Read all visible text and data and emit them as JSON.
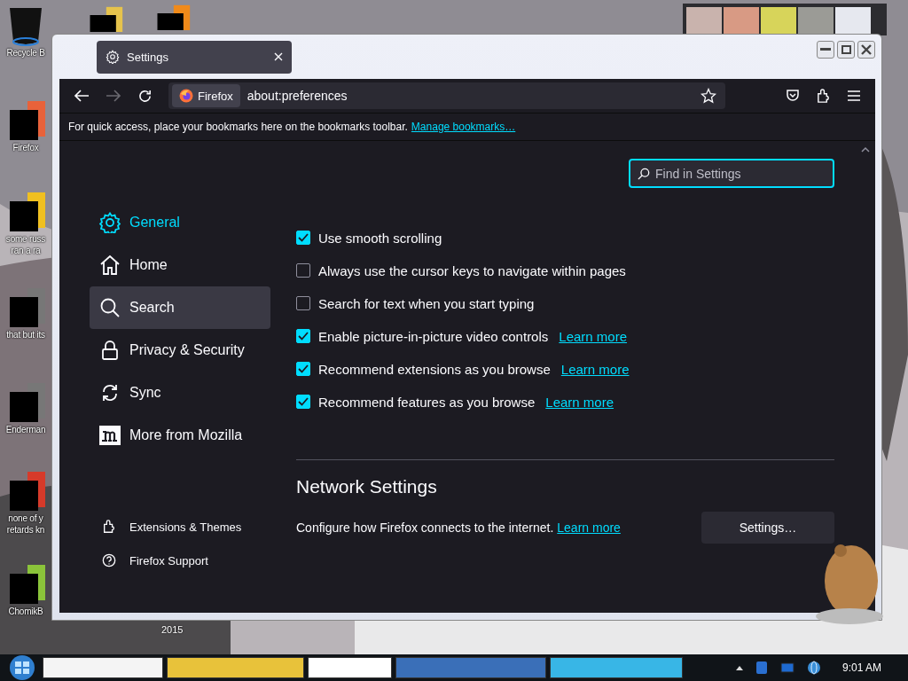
{
  "desktop": {
    "icons": [
      {
        "kind": "bin",
        "label": [
          "Recycle B"
        ]
      },
      {
        "kind": "firefox",
        "label": [
          "Firefox"
        ]
      },
      {
        "kind": "yellow",
        "label": [
          "some russ",
          "ran a ra"
        ]
      },
      {
        "kind": "stack",
        "label": [
          "that but its"
        ]
      },
      {
        "kind": "terminal",
        "label": [
          "Enderman"
        ]
      },
      {
        "kind": "red",
        "label": [
          "none of y",
          "retards kn"
        ]
      },
      {
        "kind": "hamster",
        "label": [
          "ChomikB"
        ]
      },
      {
        "kind": "folder"
      },
      {
        "kind": "orange"
      }
    ],
    "caption": "2015"
  },
  "window": {
    "tab": {
      "title": "Settings",
      "selected": true
    },
    "toolbar": {
      "identity": "Firefox",
      "url": "about:preferences"
    },
    "bookmarks_bar": {
      "text": "For quick access, place your bookmarks here on the bookmarks toolbar.",
      "link": "Manage bookmarks…"
    },
    "search": {
      "placeholder": "Find in Settings"
    },
    "sidebar": {
      "items": [
        {
          "kind": "general",
          "label": "General",
          "selected": true,
          "hovered": false
        },
        {
          "kind": "home",
          "label": "Home",
          "selected": false,
          "hovered": false
        },
        {
          "kind": "search",
          "label": "Search",
          "selected": false,
          "hovered": true
        },
        {
          "kind": "privacy",
          "label": "Privacy & Security",
          "selected": false,
          "hovered": false
        },
        {
          "kind": "sync",
          "label": "Sync",
          "selected": false,
          "hovered": false
        },
        {
          "kind": "mozilla",
          "label": "More from Mozilla",
          "selected": false,
          "hovered": false
        }
      ],
      "footer": [
        {
          "kind": "extensions",
          "label": "Extensions & Themes"
        },
        {
          "kind": "support",
          "label": "Firefox Support"
        }
      ]
    },
    "options": [
      {
        "label": "Use smooth scrolling",
        "checked": true
      },
      {
        "label": "Always use the cursor keys to navigate within pages",
        "checked": false
      },
      {
        "label": "Search for text when you start typing",
        "checked": false
      },
      {
        "label": "Enable picture-in-picture video controls",
        "checked": true,
        "link": "Learn more"
      },
      {
        "label": "Recommend extensions as you browse",
        "checked": true,
        "link": "Learn more"
      },
      {
        "label": "Recommend features as you browse",
        "checked": true,
        "link": "Learn more"
      }
    ],
    "network": {
      "heading": "Network Settings",
      "text": "Configure how Firefox connects to the internet.",
      "link": "Learn more",
      "button": "Settings…"
    }
  },
  "taskbar": {
    "buttons": [
      {
        "kind": "search"
      },
      {
        "kind": "firefox"
      },
      {
        "kind": "white"
      },
      {
        "kind": "game"
      },
      {
        "kind": "blue"
      }
    ],
    "clock": "9:01 AM"
  }
}
